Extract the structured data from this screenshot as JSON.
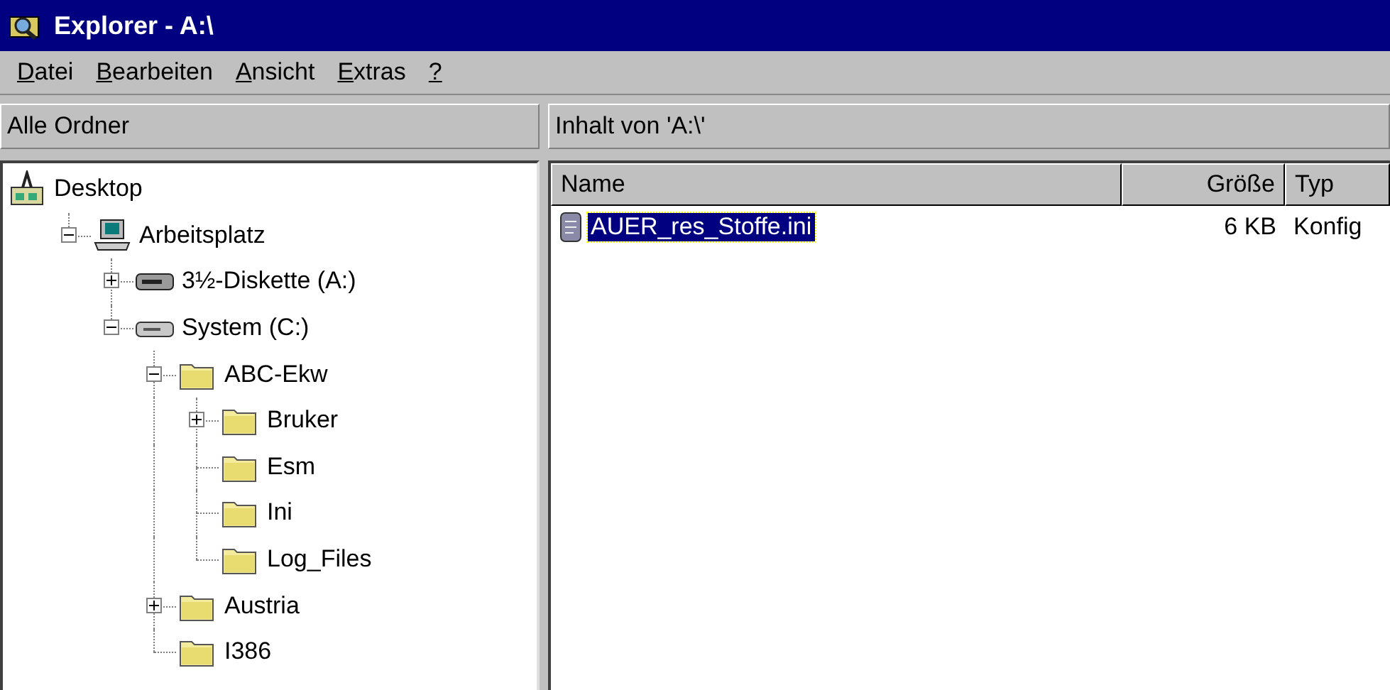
{
  "window": {
    "title": "Explorer - A:\\"
  },
  "menu": [
    {
      "accel": "D",
      "rest": "atei"
    },
    {
      "accel": "B",
      "rest": "earbeiten"
    },
    {
      "accel": "A",
      "rest": "nsicht"
    },
    {
      "accel": "E",
      "rest": "xtras"
    },
    {
      "accel": "?"
    }
  ],
  "left_header": "Alle Ordner",
  "right_header": "Inhalt von 'A:\\'",
  "tree": [
    {
      "label": "Desktop",
      "kind": "desktop",
      "children": [
        {
          "label": "Arbeitsplatz",
          "kind": "computer",
          "expanded": true,
          "children": [
            {
              "label": "3½-Diskette (A:)",
              "kind": "floppy",
              "expanded": false
            },
            {
              "label": "System (C:)",
              "kind": "drive",
              "expanded": true,
              "children": [
                {
                  "label": "ABC-Ekw",
                  "kind": "folder",
                  "expanded": true,
                  "children": [
                    {
                      "label": "Bruker",
                      "kind": "folder",
                      "expanded": false
                    },
                    {
                      "label": "Esm",
                      "kind": "folder"
                    },
                    {
                      "label": "Ini",
                      "kind": "folder"
                    },
                    {
                      "label": "Log_Files",
                      "kind": "folder"
                    }
                  ]
                },
                {
                  "label": "Austria",
                  "kind": "folder",
                  "expanded": false
                },
                {
                  "label": "I386",
                  "kind": "folder"
                }
              ]
            }
          ]
        }
      ]
    }
  ],
  "columns": [
    "Name",
    "Größe",
    "Typ"
  ],
  "files": [
    {
      "name": "AUER_res_Stoffe.ini",
      "size": "6 KB",
      "type": "Konfig",
      "selected": true
    }
  ]
}
